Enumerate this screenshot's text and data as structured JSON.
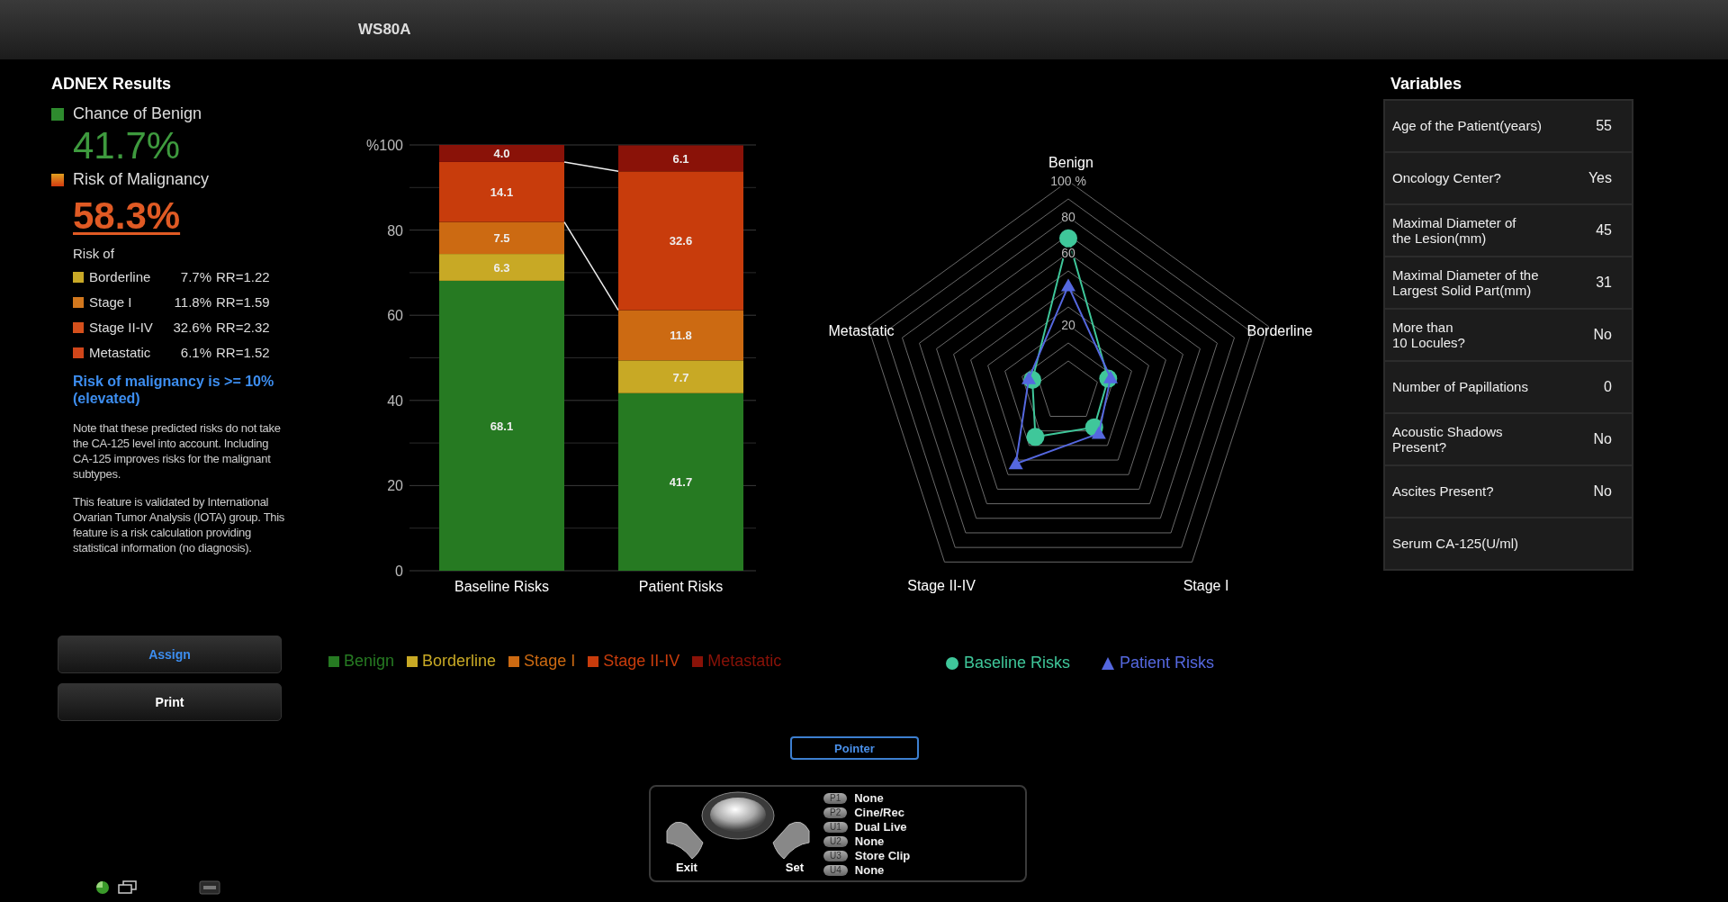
{
  "title_bar": {
    "title": "WS80A"
  },
  "results": {
    "title": "ADNEX Results",
    "benign_label": "Chance of Benign",
    "benign_value": "41.7%",
    "malignancy_label": "Risk of Malignancy",
    "malignancy_value": "58.3%",
    "subtypes_heading": "Risk of",
    "subtypes": [
      {
        "name": "Borderline",
        "percent": "7.7%",
        "rr": "RR=1.22",
        "color": "#c9a927"
      },
      {
        "name": "Stage I",
        "percent": "11.8%",
        "rr": "RR=1.59",
        "color": "#d2781e"
      },
      {
        "name": "Stage II-IV",
        "percent": "32.6%",
        "rr": "RR=2.32",
        "color": "#d5501c"
      },
      {
        "name": "Metastatic",
        "percent": "6.1%",
        "rr": "RR=1.52",
        "color": "#d0461a"
      }
    ],
    "alert": "Risk of malignancy is >= 10% (elevated)",
    "notes": [
      "Note that these predicted risks do not take the CA-125 level into account. Including CA-125 improves risks for the malignant subtypes.",
      "This feature is validated by International Ovarian Tumor Analysis (IOTA) group. This feature is a risk calculation providing statistical information (no diagnosis)."
    ]
  },
  "buttons": [
    {
      "label": "Assign",
      "selected": true
    },
    {
      "label": "Print",
      "selected": false
    }
  ],
  "bar_chart": {
    "chart_data": {
      "type": "bar",
      "stacked": true,
      "grid": true,
      "categories": [
        "Baseline Risks",
        "Patient Risks"
      ],
      "ylim": [
        0,
        100
      ],
      "yticks": [
        0,
        20,
        40,
        60,
        80,
        {
          "value": 100,
          "label": "%100"
        }
      ],
      "series": [
        {
          "name": "Benign",
          "color": "#267a22",
          "values": [
            68.1,
            41.7
          ],
          "value_labels": [
            "68.1",
            "41.7"
          ]
        },
        {
          "name": "Borderline",
          "color": "#c8a925",
          "values": [
            6.3,
            7.7
          ],
          "value_labels": [
            "6.3",
            "7.7"
          ]
        },
        {
          "name": "Stage I",
          "color": "#cc6a12",
          "values": [
            7.5,
            11.8
          ],
          "value_labels": [
            "7.5",
            "11.8"
          ]
        },
        {
          "name": "Stage II-IV",
          "color": "#c83c0c",
          "values": [
            14.1,
            32.6
          ],
          "value_labels": [
            "14.1",
            "32.6"
          ]
        },
        {
          "name": "Metastatic",
          "color": "#8a1208",
          "values": [
            4.0,
            6.1
          ],
          "value_labels": [
            "4.0",
            "6.1"
          ]
        }
      ]
    }
  },
  "radar_chart": {
    "chart_data": {
      "type": "radar",
      "categories": [
        "Benign",
        "Borderline",
        "Stage I",
        "Stage II-IV",
        "Metastatic"
      ],
      "ylim": [
        -17,
        100
      ],
      "yticks": [
        20,
        60,
        80,
        {
          "value": 100,
          "label": "100 %"
        }
      ],
      "series": [
        {
          "name": "Baseline Risks",
          "color": "#3fc79a",
          "values": [
            68.1,
            6.3,
            7.5,
            14.1,
            4.0
          ]
        },
        {
          "name": "Patient Risks",
          "color": "#5568e0",
          "values": [
            41.7,
            7.7,
            11.8,
            32.6,
            6.1
          ]
        }
      ]
    }
  },
  "variables": {
    "title": "Variables",
    "rows": [
      {
        "label": "Age of the Patient(years)",
        "value": "55"
      },
      {
        "label": "Oncology Center?",
        "value": "Yes"
      },
      {
        "label": "Maximal Diameter of\nthe Lesion(mm)",
        "value": "45"
      },
      {
        "label": "Maximal Diameter of the\nLargest Solid Part(mm)",
        "value": "31"
      },
      {
        "label": "More than\n10 Locules?",
        "value": "No"
      },
      {
        "label": "Number of Papillations",
        "value": "0"
      },
      {
        "label": "Acoustic Shadows\nPresent?",
        "value": "No"
      },
      {
        "label": "Ascites Present?",
        "value": "No"
      },
      {
        "label": "Serum CA-125(U/ml)"
      }
    ]
  },
  "pointer_button": {
    "label": "Pointer"
  },
  "trackball": {
    "exit_label": "Exit",
    "set_label": "Set",
    "keys": [
      {
        "key": "P1",
        "action": "None"
      },
      {
        "key": "P2",
        "action": "Cine/Rec"
      },
      {
        "key": "U1",
        "action": "Dual Live"
      },
      {
        "key": "U2",
        "action": "None"
      },
      {
        "key": "U3",
        "action": "Store Clip"
      },
      {
        "key": "U4",
        "action": "None"
      }
    ]
  }
}
